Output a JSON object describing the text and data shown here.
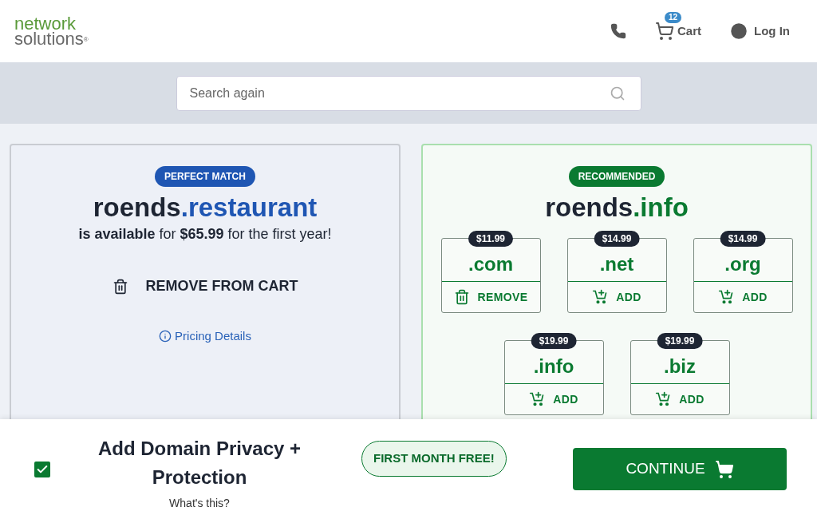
{
  "header": {
    "logo": {
      "line_1": "network",
      "line_2": "solutions",
      "mark": "®"
    },
    "cart": {
      "badge": "12",
      "label": "Cart"
    },
    "login": "Log In"
  },
  "search": {
    "placeholder": "Search again"
  },
  "perfect_match": {
    "badge": "PERFECT MATCH",
    "domain_name": "roends",
    "tld": ".restaurant",
    "availability": "**is available** for **$65.99** for the first year!",
    "action": "REMOVE FROM CART",
    "pricing_link": "Pricing Details"
  },
  "recommended": {
    "badge": "RECOMMENDED",
    "domain_name": "roends",
    "tld": ".info",
    "options": [
      {
        "price": "$11.99",
        "tld": ".com",
        "in_cart": true,
        "action": "REMOVE"
      },
      {
        "price": "$14.99",
        "tld": ".net",
        "in_cart": false,
        "action": "ADD"
      },
      {
        "price": "$14.99",
        "tld": ".org",
        "in_cart": false,
        "action": "ADD"
      },
      {
        "price": "$19.99",
        "tld": ".info",
        "in_cart": false,
        "action": "ADD"
      },
      {
        "price": "$19.99",
        "tld": ".biz",
        "in_cart": false,
        "action": "ADD"
      }
    ]
  },
  "privacy": {
    "checked": true,
    "title": "Add Domain Privacy + Protection",
    "help_link": "What's this?",
    "promo": "FIRST MONTH FREE!"
  },
  "continue_button": "CONTINUE"
}
